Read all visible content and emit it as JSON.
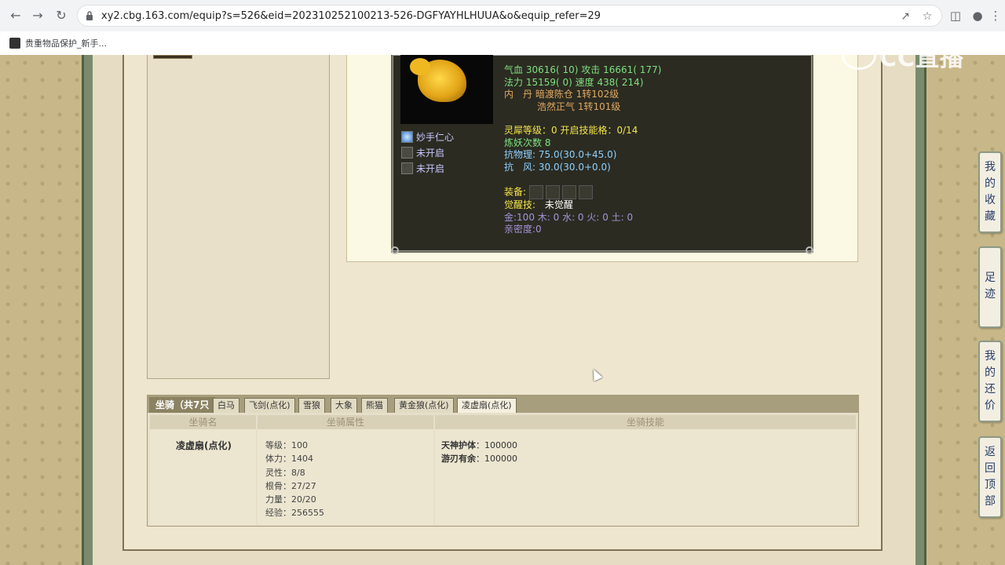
{
  "browser": {
    "url": "xy2.cbg.163.com/equip?s=526&eid=202310252100213-526-DGFYAYHLHUUA&o&equip_refer=29",
    "bookmark_label": "贵重物品保护_新手..."
  },
  "watermark": "CC直播",
  "pet": {
    "stat_rows": [
      {
        "k1": "气血",
        "v1": "30616( 10)",
        "k2": "攻击",
        "v2": "16661( 177)"
      },
      {
        "k1": "法力",
        "v1": "15159( 0)",
        "k2": "速度",
        "v2": "438( 214)"
      }
    ],
    "neidan_label": "内　丹",
    "neidan_1": "暗渡陈仓 1转102级",
    "neidan_2": "浩然正气 1转101级",
    "lingxi": "灵犀等级：0 开启技能格：0/14",
    "lianyao": "炼妖次数 8",
    "resist_1": "抗物理: 75.0(30.0+45.0)",
    "resist_2": "抗　风: 30.0(30.0+0.0)",
    "equip_label": "装备:",
    "awaken_label": "觉醒技:",
    "awaken_value": "未觉醒",
    "elements": "金:100 木: 0 水: 0 火: 0 土: 0",
    "intimacy": "亲密度:0",
    "skills": [
      "妙手仁心",
      "未开启",
      "未开启"
    ]
  },
  "side_buttons": [
    {
      "label": [
        "我",
        "的",
        "收",
        "藏"
      ]
    },
    {
      "label": [
        "足",
        "迹"
      ]
    },
    {
      "label": [
        "我",
        "的",
        "还",
        "价"
      ]
    },
    {
      "label": [
        "返",
        "回",
        "顶",
        "部"
      ]
    }
  ],
  "mount": {
    "title": "坐骑（共7只",
    "tabs": [
      "白马",
      "飞剑(点化)",
      "雪狼",
      "大象",
      "熊猫",
      "黄金狼(点化)",
      "凌虚扇(点化)"
    ],
    "active_tab": 6,
    "headers": [
      "坐骑名",
      "坐骑属性",
      "坐骑技能"
    ],
    "name": "凌虚扇(点化)",
    "attributes": [
      "等级：100",
      "体力：1404",
      "灵性：8/8",
      "根骨：27/27",
      "力量：20/20",
      "经验：256555"
    ],
    "skills": [
      {
        "name": "天神护体",
        "value": "：100000"
      },
      {
        "name": "游刃有余",
        "value": "：100000"
      }
    ]
  }
}
